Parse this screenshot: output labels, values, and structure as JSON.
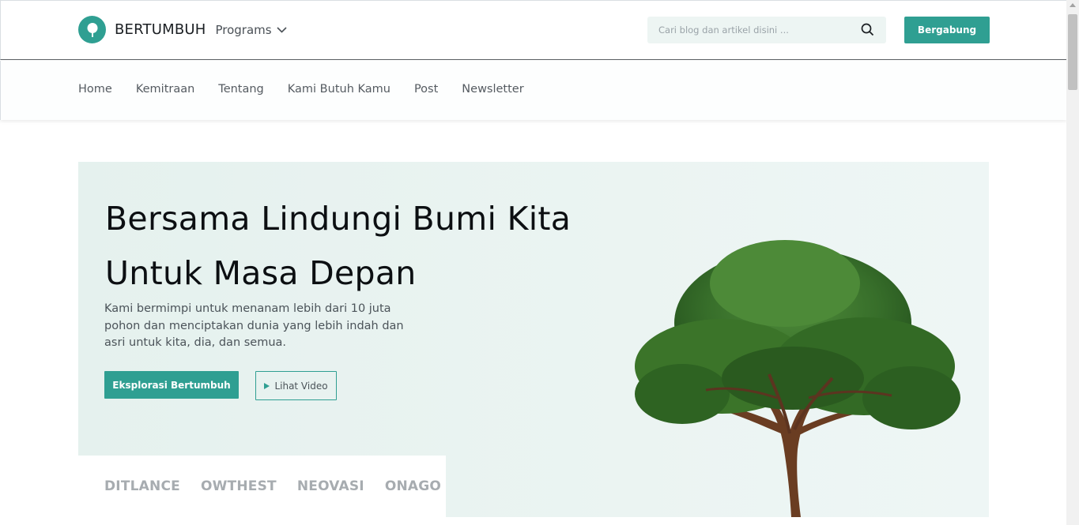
{
  "header": {
    "brand": "BERTUMBUH",
    "programs_label": "Programs",
    "search": {
      "placeholder": "Cari blog dan artikel disini ..."
    },
    "join_label": "Bergabung"
  },
  "nav": {
    "items": [
      "Home",
      "Kemitraan",
      "Tentang",
      "Kami Butuh Kamu",
      "Post",
      "Newsletter"
    ]
  },
  "hero": {
    "title_line1": "Bersama Lindungi Bumi Kita",
    "title_line2": "Untuk Masa Depan",
    "description": "Kami bermimpi untuk menanam lebih dari 10 juta pohon dan menciptakan dunia yang lebih indah dan asri untuk kita, dia, dan semua.",
    "explore_label": "Eksplorasi Bertumbuh",
    "video_label": "Lihat Video"
  },
  "partners": [
    "DITLANCE",
    "OWTHEST",
    "NEOVASI",
    "ONAGO"
  ],
  "colors": {
    "accent": "#2f9f92",
    "hero_bg": "#e5f1ee",
    "search_bg": "#edf5f3"
  },
  "icons": {
    "logo": "tree-logo-icon",
    "programs": "chevron-down-icon",
    "search": "search-icon",
    "video": "play-icon"
  }
}
